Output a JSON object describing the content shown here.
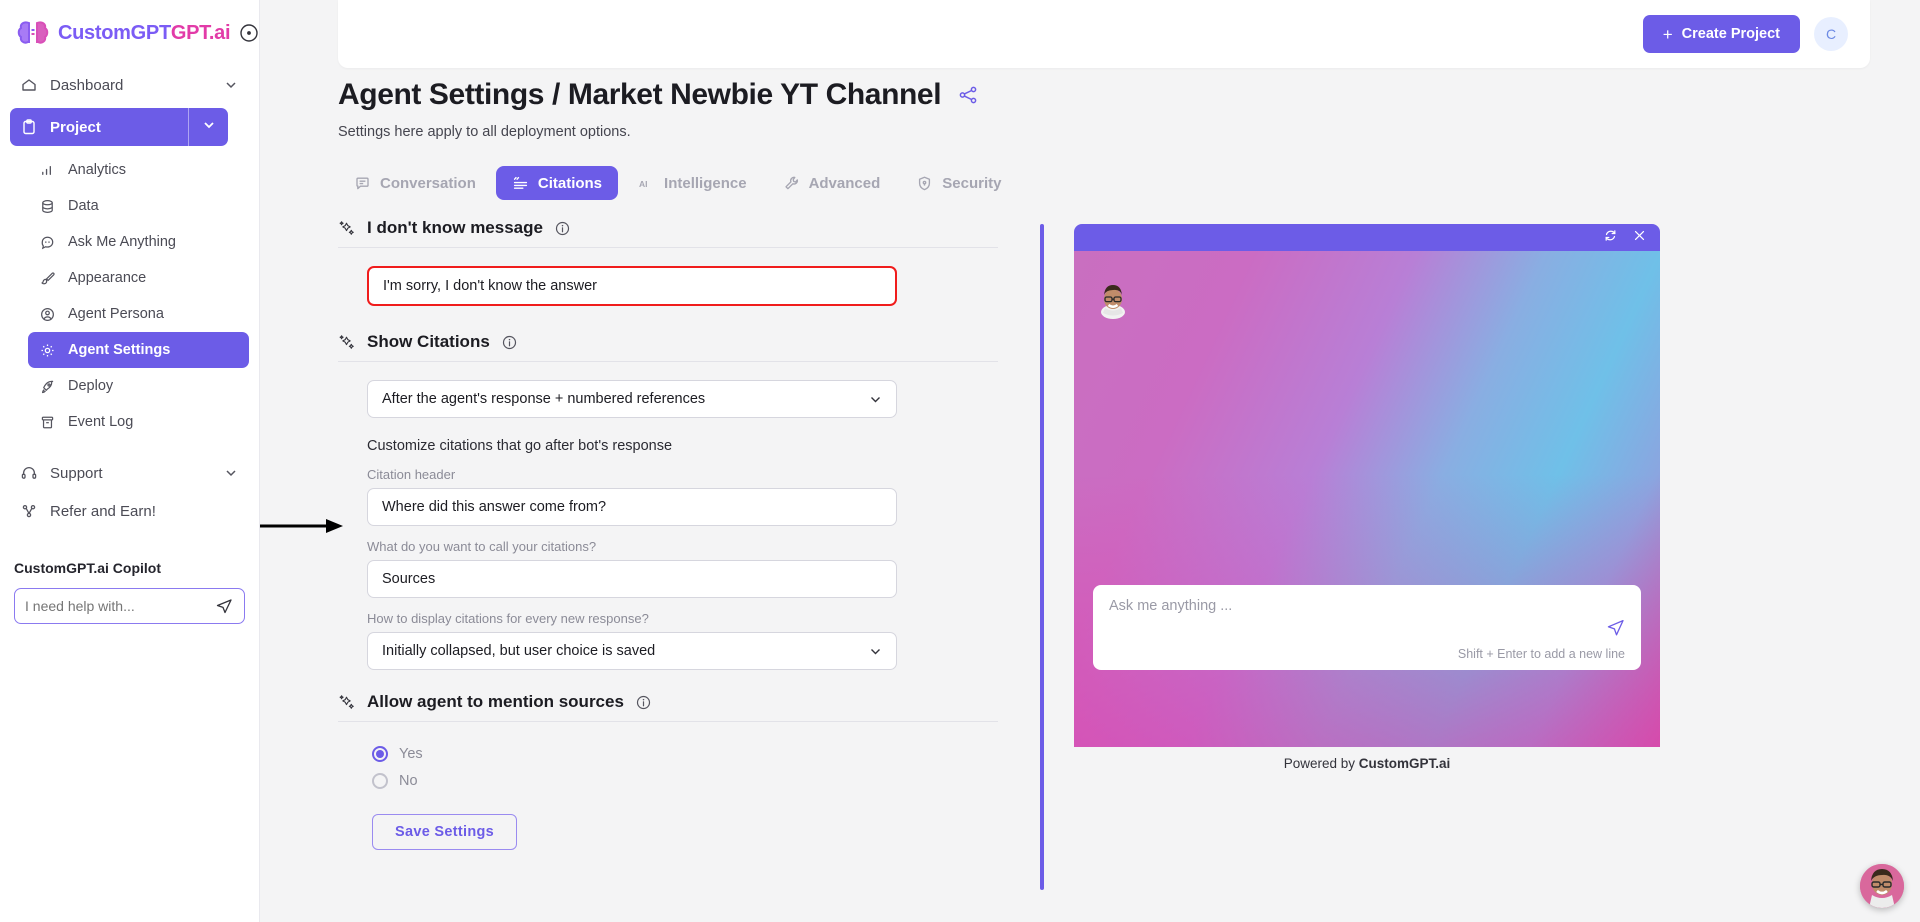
{
  "brand": {
    "name_custom": "CustomGPT",
    "name_gpt": ".ai",
    "collapse_icon": "collapse-circle-icon"
  },
  "sidebar": {
    "top_items": [
      {
        "label": "Dashboard",
        "icon": "home-icon",
        "has_chevron": true
      },
      {
        "label": "Project",
        "icon": "clipboard-icon",
        "has_chevron": true,
        "active": true
      }
    ],
    "sub_items": [
      {
        "label": "Analytics",
        "icon": "bar-chart-icon"
      },
      {
        "label": "Data",
        "icon": "database-icon"
      },
      {
        "label": "Ask Me Anything",
        "icon": "chat-bubble-icon"
      },
      {
        "label": "Appearance",
        "icon": "paintbrush-icon"
      },
      {
        "label": "Agent Persona",
        "icon": "user-circle-icon"
      },
      {
        "label": "Agent Settings",
        "icon": "gear-icon",
        "active": true
      },
      {
        "label": "Deploy",
        "icon": "rocket-icon"
      },
      {
        "label": "Event Log",
        "icon": "archive-icon"
      }
    ],
    "bottom_items": [
      {
        "label": "Support",
        "icon": "headset-icon",
        "has_chevron": true
      },
      {
        "label": "Refer and Earn!",
        "icon": "share-nodes-icon"
      }
    ],
    "copilot": {
      "title": "CustomGPT.ai Copilot",
      "placeholder": "I need help with...",
      "value": "",
      "send_icon": "send-paper-plane-icon"
    }
  },
  "topbar": {
    "create_label": "Create Project",
    "plus_icon": "plus-icon",
    "avatar_initial": "C"
  },
  "page": {
    "title": "Agent Settings / Market Newbie YT Channel",
    "share_icon": "share-icon",
    "subtitle": "Settings here apply to all deployment options."
  },
  "tabs": [
    {
      "label": "Conversation",
      "icon": "message-square-icon",
      "active": false
    },
    {
      "label": "Citations",
      "icon": "quote-list-icon",
      "active": true
    },
    {
      "label": "Intelligence",
      "icon": "ai-icon",
      "active": false
    },
    {
      "label": "Advanced",
      "icon": "wrench-icon",
      "active": false
    },
    {
      "label": "Security",
      "icon": "shield-lock-icon",
      "active": false
    }
  ],
  "form": {
    "idk": {
      "title": "I don't know message",
      "info_icon": "info-icon",
      "sparkle_icon": "sparkle-icon",
      "value": "I'm sorry, I don't know the answer",
      "highlighted": true,
      "highlight_color": "#f01c1c"
    },
    "show_citations": {
      "title": "Show Citations",
      "info_icon": "info-icon",
      "sparkle_icon": "sparkle-icon",
      "select_value": "After the agent's response + numbered references",
      "chevron_icon": "chevron-down-icon",
      "note": "Customize citations that go after bot's response",
      "header_label": "Citation header",
      "header_value": "Where did this answer come from?",
      "call_label": "What do you want to call your citations?",
      "call_value": "Sources",
      "display_label": "How to display citations for every new response?",
      "display_value": "Initially collapsed, but user choice is saved"
    },
    "mention_sources": {
      "title": "Allow agent to mention sources",
      "info_icon": "info-icon",
      "sparkle_icon": "sparkle-icon",
      "options": [
        {
          "label": "Yes",
          "selected": true
        },
        {
          "label": "No",
          "selected": false
        }
      ]
    },
    "save_label": "Save Settings"
  },
  "chat_preview": {
    "refresh_icon": "refresh-icon",
    "close_icon": "close-icon",
    "avatar_icon": "bot-avatar-icon",
    "placeholder": "Ask me anything ...",
    "send_icon": "send-paper-plane-icon",
    "hint": "Shift + Enter to add a new line",
    "powered_prefix": "Powered by ",
    "powered_brand": "CustomGPT.ai",
    "float_avatar_icon": "floating-chat-avatar-icon"
  },
  "colors": {
    "accent": "#6c5ce7",
    "brand_pink": "#e23ba8",
    "highlight_red": "#f01c1c"
  }
}
